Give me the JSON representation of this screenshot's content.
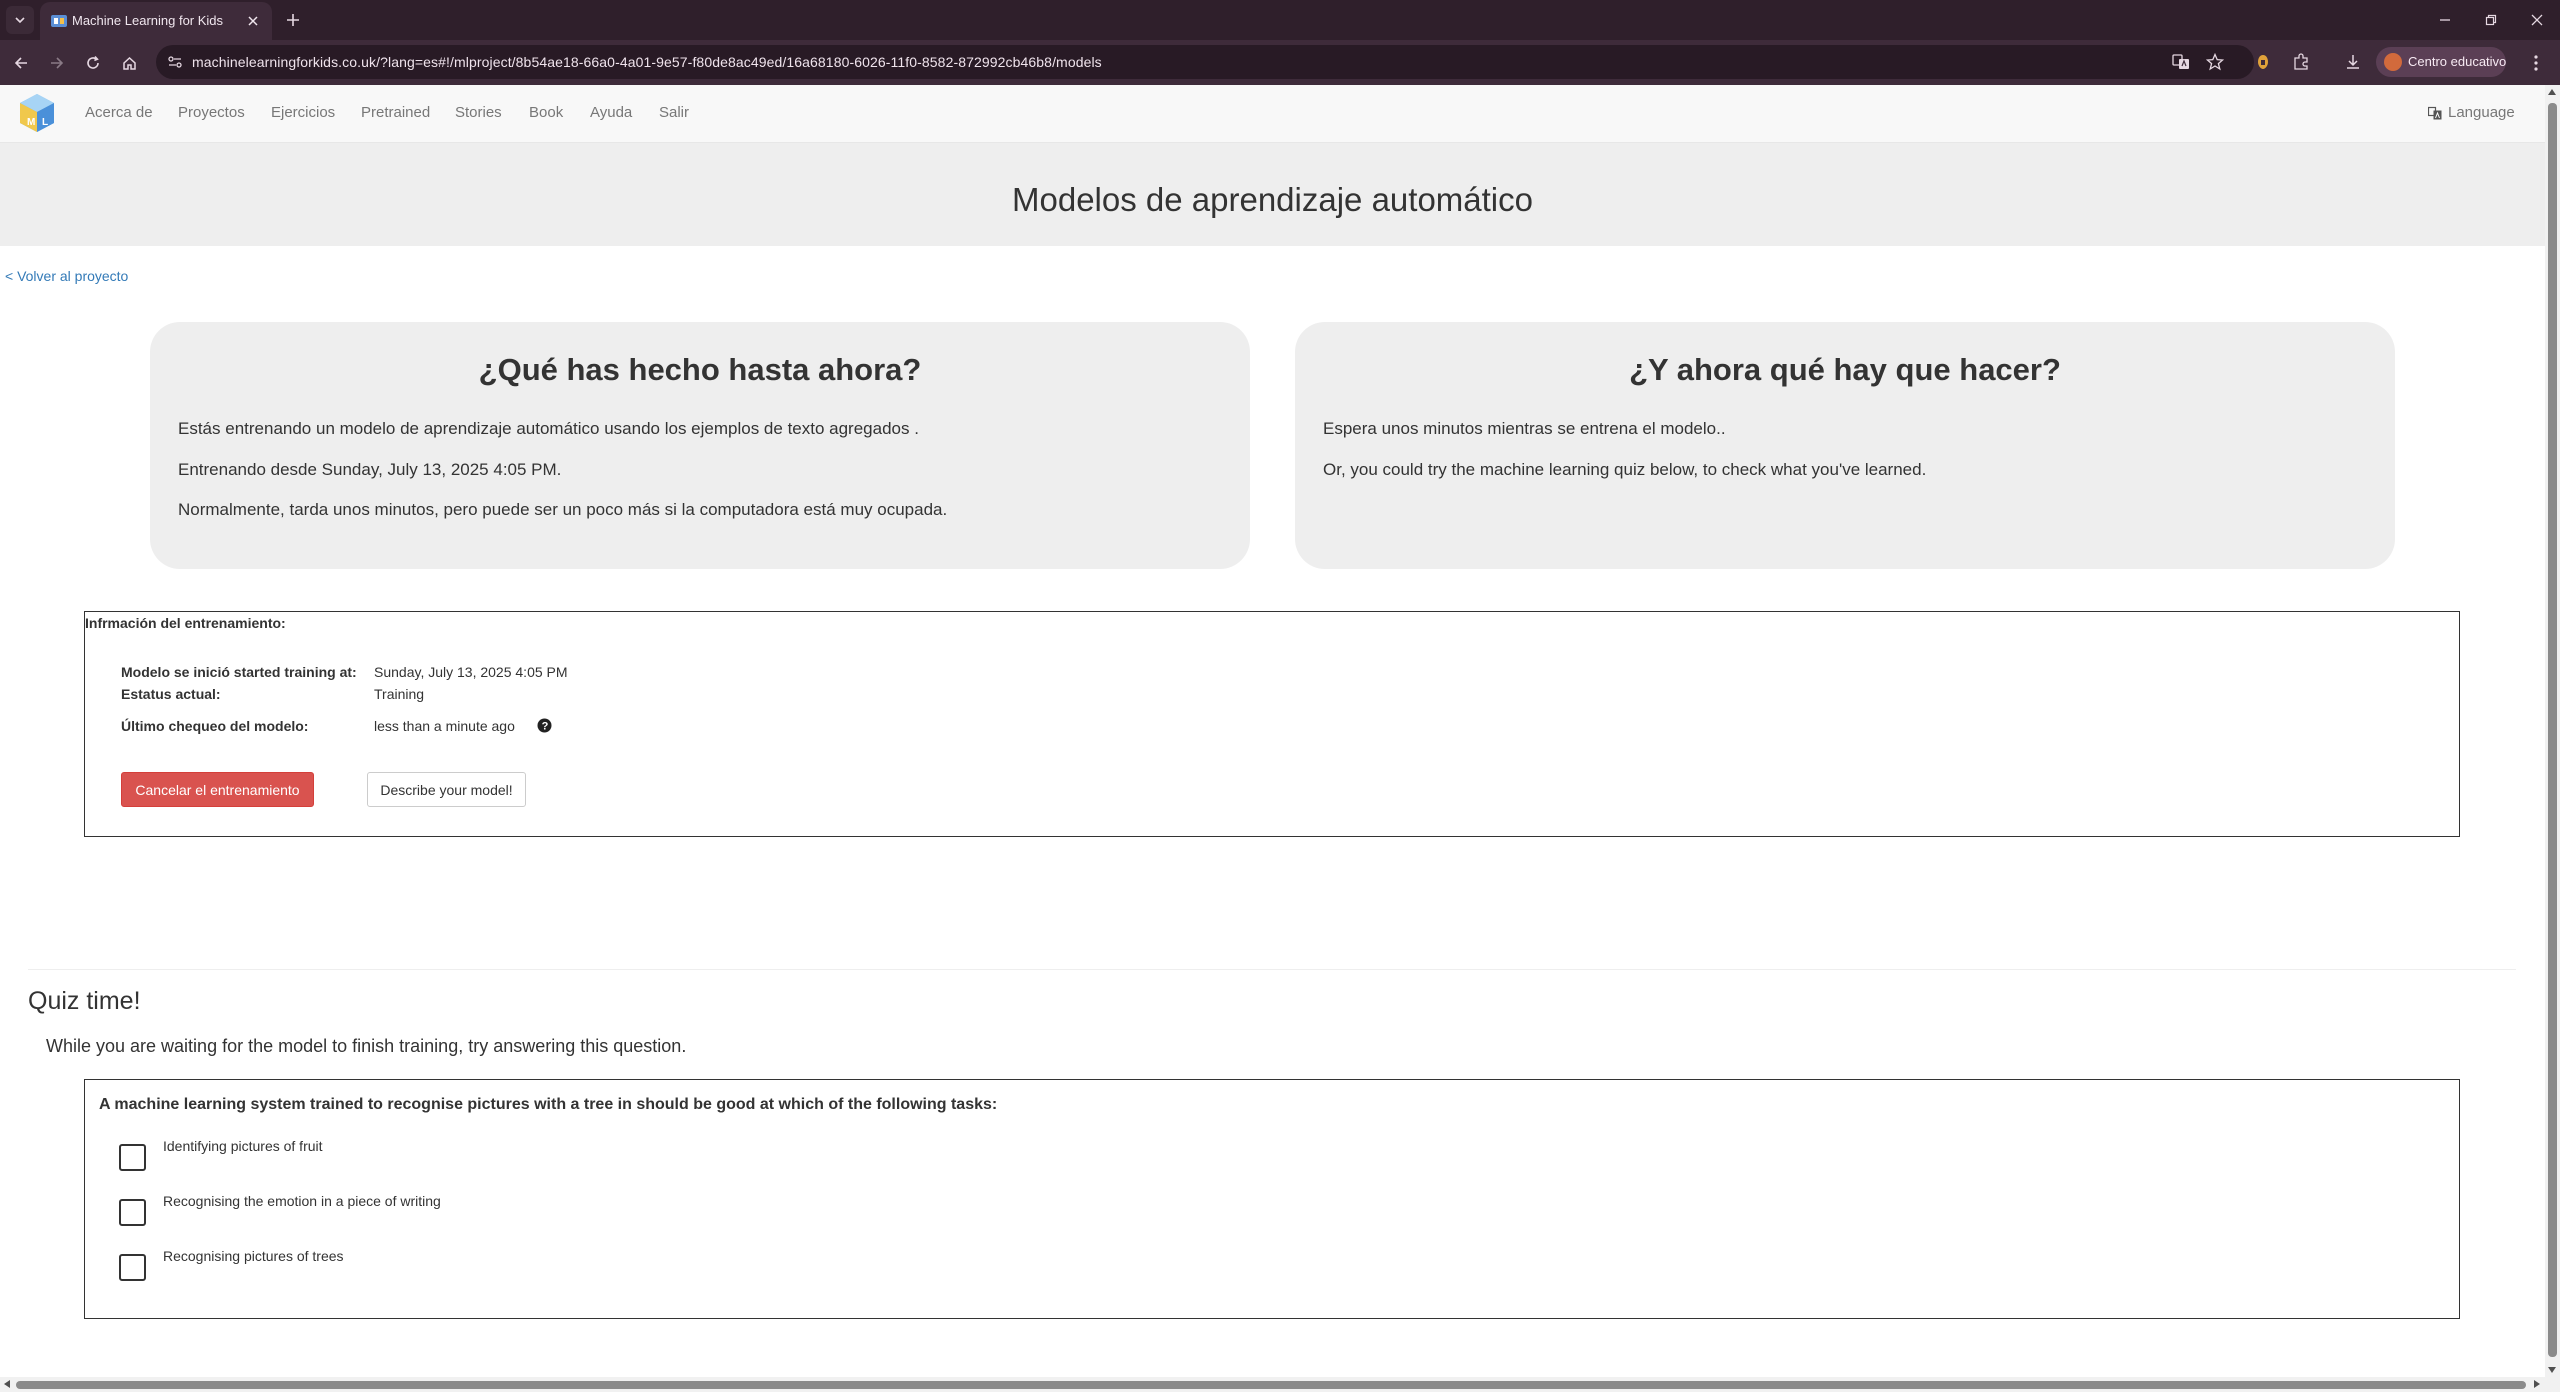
{
  "browser": {
    "tab_title": "Machine Learning for Kids",
    "url": "machinelearningforkids.co.uk/?lang=es#!/mlproject/8b54ae18-66a0-4a01-9e57-f80de8ac49ed/16a68180-6026-11f0-8582-872992cb46b8/models",
    "profile_name": "Centro educativo"
  },
  "nav": {
    "items": [
      "Acerca de",
      "Proyectos",
      "Ejercicios",
      "Pretrained",
      "Stories",
      "Book",
      "Ayuda",
      "Salir"
    ],
    "language": "Language"
  },
  "page": {
    "title": "Modelos de aprendizaje automático",
    "back_link": "< Volver al proyecto"
  },
  "cards": {
    "left": {
      "heading": "¿Qué has hecho hasta ahora?",
      "lines": [
        "Estás entrenando un modelo de aprendizaje automático usando los ejemplos de texto agregados .",
        "Entrenando desde Sunday, July 13, 2025 4:05 PM.",
        "Normalmente, tarda unos minutos, pero puede ser un poco más si la computadora está muy ocupada."
      ]
    },
    "right": {
      "heading": "¿Y ahora qué hay que hacer?",
      "lines": [
        "Espera unos minutos mientras se entrena el modelo..",
        "Or, you could try the machine learning quiz below, to check what you've learned."
      ]
    }
  },
  "training": {
    "heading": "Infrmación del entrenamiento:",
    "started_label": "Modelo se inició started training at:",
    "started_value": "Sunday, July 13, 2025 4:05 PM",
    "status_label": "Estatus actual:",
    "status_value": "Training",
    "check_label": "Último chequeo del modelo:",
    "check_value": "less than a minute ago",
    "cancel_button": "Cancelar el entrenamiento",
    "describe_button": "Describe your model!"
  },
  "quiz": {
    "title": "Quiz time!",
    "intro": "While you are waiting for the model to finish training, try answering this question.",
    "question": "A machine learning system trained to recognise pictures with a tree in should be good at which of the following tasks:",
    "options": [
      "Identifying pictures of fruit",
      "Recognising the emotion in a piece of writing",
      "Recognising pictures of trees"
    ]
  },
  "colors": {
    "chrome_dark": "#2f1f2b",
    "chrome_toolbar": "#3e2b3a",
    "link": "#337ab7",
    "danger": "#d9534f",
    "panel": "#eeeeee"
  },
  "icons": [
    "tab-list-icon",
    "favicon-icon",
    "close-icon",
    "plus-icon",
    "minimize-icon",
    "restore-icon",
    "back-icon",
    "forward-icon",
    "reload-icon",
    "home-icon",
    "site-info-icon",
    "translate-icon",
    "star-icon",
    "extension-icon",
    "puzzle-icon",
    "download-icon",
    "menu-icon",
    "logo-icon",
    "language-icon",
    "help-icon",
    "checkbox-icon"
  ]
}
